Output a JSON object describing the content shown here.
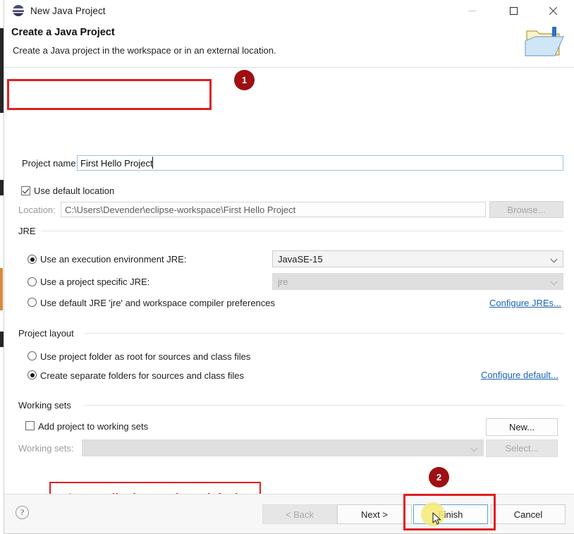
{
  "window": {
    "title": "New Java Project",
    "icon": "eclipse-sphere-icon",
    "controls": {
      "minimize": "minimize-icon",
      "maximize": "maximize-icon",
      "close": "close-icon"
    }
  },
  "header": {
    "title": "Create a Java Project",
    "subtitle": "Create a Java project in the workspace or in an external location.",
    "icon": "new-java-project-folder-icon"
  },
  "form": {
    "project_name_label": "Project name:",
    "project_name_value": "First Hello Project",
    "use_default_location_label": "Use default location",
    "use_default_location_checked": true,
    "location_label": "Location:",
    "location_value": "C:\\Users\\Devender\\eclipse-workspace\\First Hello Project",
    "browse_label": "Browse..."
  },
  "jre": {
    "group_label": "JRE",
    "options": [
      {
        "label": "Use an execution environment JRE:",
        "selected": true
      },
      {
        "label": "Use a project specific JRE:",
        "selected": false
      },
      {
        "label": "Use default JRE 'jre' and workspace compiler preferences",
        "selected": false
      }
    ],
    "execution_env_value": "JavaSE-15",
    "project_jre_value": "jre",
    "configure_link": "Configure JREs..."
  },
  "project_layout": {
    "group_label": "Project layout",
    "options": [
      {
        "label": "Use project folder as root for sources and class files",
        "selected": false
      },
      {
        "label": "Create separate folders for sources and class files",
        "selected": true
      }
    ],
    "configure_link": "Configure default..."
  },
  "working_sets": {
    "group_label": "Working sets",
    "add_label": "Add project to working sets",
    "add_checked": false,
    "sets_label": "Working sets:",
    "sets_value": "",
    "new_label": "New...",
    "select_label": "Select..."
  },
  "footer": {
    "help_icon": "?",
    "back_label": "< Back",
    "next_label": "Next >",
    "finish_label": "Finish",
    "cancel_label": "Cancel"
  },
  "annotations": {
    "badge_one": "1",
    "badge_two": "2",
    "note": "Leave all other settings default",
    "highlight_color": "#e02020",
    "badge_color": "#9d0f12",
    "note_text_color": "#e8191c"
  }
}
